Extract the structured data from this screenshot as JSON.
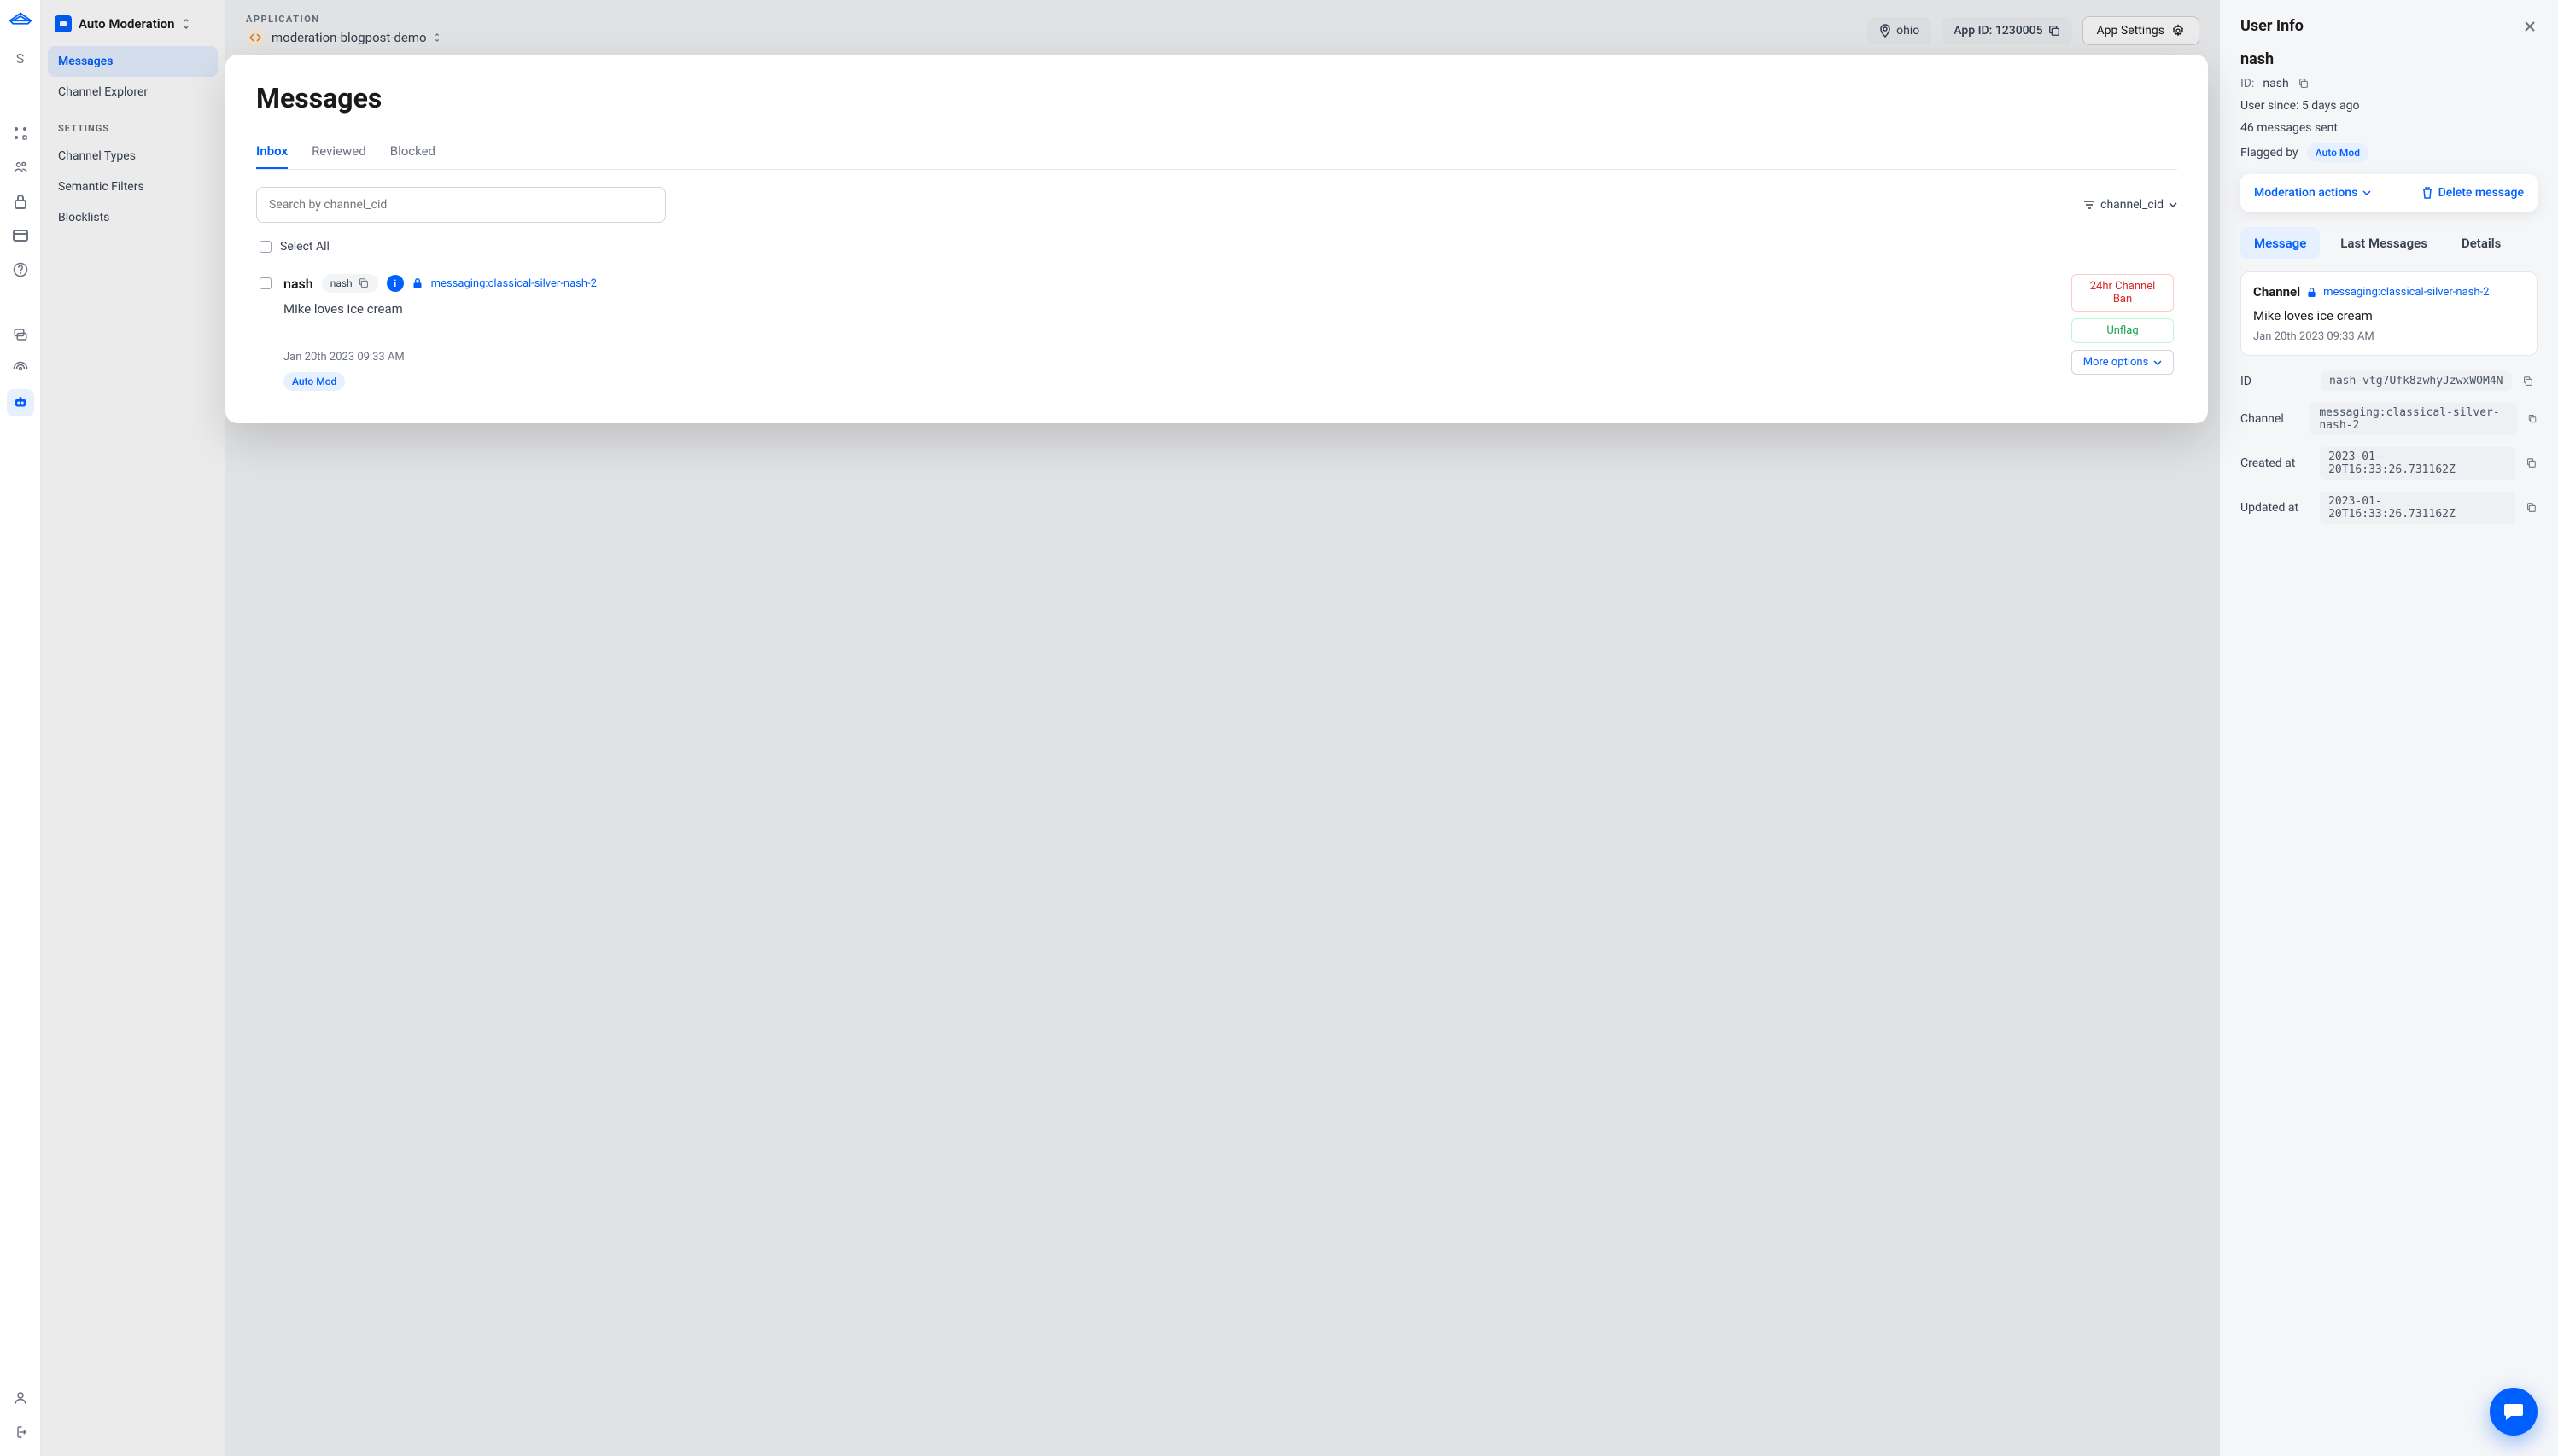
{
  "sidebar": {
    "product_title": "Auto Moderation",
    "workspace_initial": "S",
    "items": [
      "Messages",
      "Channel Explorer"
    ],
    "settings_heading": "SETTINGS",
    "settings_items": [
      "Channel Types",
      "Semantic Filters",
      "Blocklists"
    ]
  },
  "topbar": {
    "app_label": "APPLICATION",
    "app_name": "moderation-blogpost-demo",
    "region": "ohio",
    "app_id_label": "App ID: 1230005",
    "settings_btn": "App Settings"
  },
  "messages": {
    "title": "Messages",
    "tabs": [
      "Inbox",
      "Reviewed",
      "Blocked"
    ],
    "search_placeholder": "Search by channel_cid",
    "filter_label": "channel_cid",
    "select_all": "Select All",
    "item": {
      "sender": "nash",
      "sender_id": "nash",
      "channel_cid": "messaging:classical-silver-nash-2",
      "text": "Mike loves ice cream",
      "timestamp": "Jan 20th 2023 09:33 AM",
      "flag_badge": "Auto Mod",
      "actions": {
        "ban": "24hr Channel Ban",
        "unflag": "Unflag",
        "more": "More options"
      }
    }
  },
  "user_panel": {
    "title": "User Info",
    "username": "nash",
    "id_label": "ID:",
    "id_value": "nash",
    "since": "User since: 5 days ago",
    "sent": "46 messages sent",
    "flagged_label": "Flagged by",
    "flagged_badge": "Auto Mod",
    "mod_actions": "Moderation actions",
    "delete_msg": "Delete message",
    "detail_tabs": [
      "Message",
      "Last Messages",
      "Details"
    ],
    "channel_box": {
      "label": "Channel",
      "cid": "messaging:classical-silver-nash-2",
      "text": "Mike loves ice cream",
      "time": "Jan 20th 2023 09:33 AM"
    },
    "meta": {
      "id_label": "ID",
      "id_val": "nash-vtg7Ufk8zwhyJzwxWOM4N",
      "channel_label": "Channel",
      "channel_val": "messaging:classical-silver-nash-2",
      "created_label": "Created at",
      "created_val": "2023-01-20T16:33:26.731162Z",
      "updated_label": "Updated at",
      "updated_val": "2023-01-20T16:33:26.731162Z"
    }
  }
}
